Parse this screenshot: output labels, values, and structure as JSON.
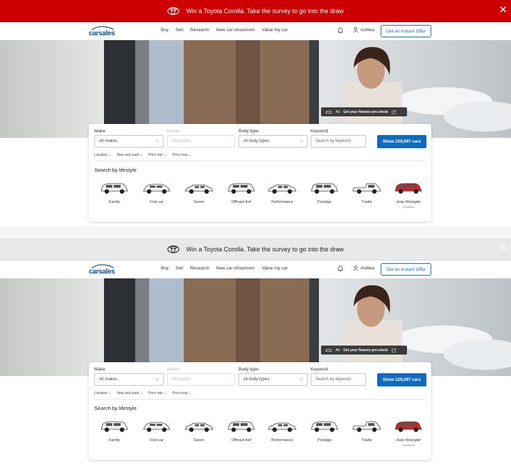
{
  "banner": {
    "text": "Win a Toyota Corolla. Take the survey to go into the draw",
    "close": "✕"
  },
  "nav": {
    "logo": "carsales",
    "links": [
      "Buy",
      "Sell",
      "Research",
      "New car showroom",
      "Value my car"
    ],
    "user": "Ashlea",
    "offer": "Get an Instant Offer"
  },
  "hero": {
    "ad_label": "Ad",
    "ad_text": "Get your finance pre-check"
  },
  "search": {
    "make_label": "Make",
    "make_value": "All makes",
    "model_label": "Model",
    "model_value": "All models",
    "body_label": "Body type",
    "body_value": "All body types",
    "keyword_label": "Keyword",
    "keyword_placeholder": "Search by keyword",
    "show_button": "Show 229,097 cars",
    "filters": [
      "Location",
      "New and used",
      "Price min",
      "Price max"
    ]
  },
  "lifestyle": {
    "title": "Search by lifestyle",
    "items": [
      {
        "label": "Family",
        "sub": ""
      },
      {
        "label": "First car",
        "sub": ""
      },
      {
        "label": "Green",
        "sub": ""
      },
      {
        "label": "Offroad 4x4",
        "sub": ""
      },
      {
        "label": "Performance",
        "sub": ""
      },
      {
        "label": "Prestige",
        "sub": ""
      },
      {
        "label": "Tradie",
        "sub": ""
      },
      {
        "label": "Jeep Wrangler",
        "sub": "Sponsored"
      }
    ]
  },
  "colors": {
    "banner_active": "#cc0000",
    "banner_inactive": "#e7e9eb",
    "primary_blue": "#0e6bbd",
    "jeep_red": "#c9252b"
  }
}
